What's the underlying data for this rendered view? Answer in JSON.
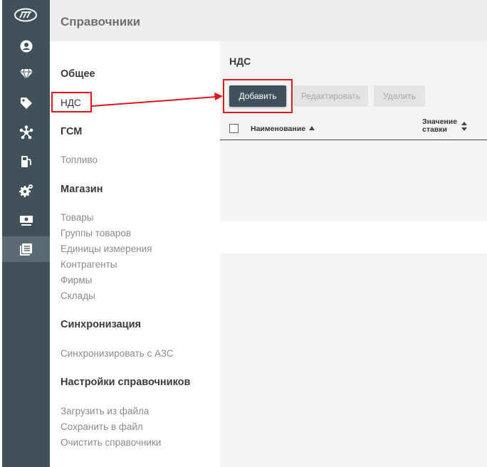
{
  "header": {
    "title": "Справочники"
  },
  "rail": {
    "items": [
      {
        "icon": "user-icon"
      },
      {
        "icon": "diamond-icon"
      },
      {
        "icon": "tag-icon"
      },
      {
        "icon": "network-icon"
      },
      {
        "icon": "fuel-pump-icon"
      },
      {
        "icon": "gears-icon"
      },
      {
        "icon": "cash-icon"
      },
      {
        "icon": "book-icon",
        "active": true
      }
    ]
  },
  "menu": {
    "general": {
      "title": "Общее",
      "items": [
        "НДС"
      ]
    },
    "fuel": {
      "title": "ГСМ",
      "items": [
        "Топливо"
      ]
    },
    "shop": {
      "title": "Магазин",
      "items": [
        "Товары",
        "Группы товаров",
        "Единицы измерения",
        "Контрагенты",
        "Фирмы",
        "Склады"
      ]
    },
    "sync": {
      "title": "Синхронизация",
      "items": [
        "Синхронизировать с АЗС"
      ]
    },
    "settings": {
      "title": "Настройки справочников",
      "items": [
        "Загрузить из файла",
        "Сохранить в файл",
        "Очистить справочники"
      ]
    }
  },
  "content": {
    "title": "НДС",
    "buttons": {
      "add": "Добавить",
      "edit": "Редактировать",
      "delete": "Удалить"
    },
    "table": {
      "col_name": "Наименование",
      "col_rate_1": "Значение",
      "col_rate_2": "ставки"
    }
  },
  "colors": {
    "rail": "#40515a",
    "primary_button": "#3f515c",
    "annotation": "#e0161e"
  }
}
